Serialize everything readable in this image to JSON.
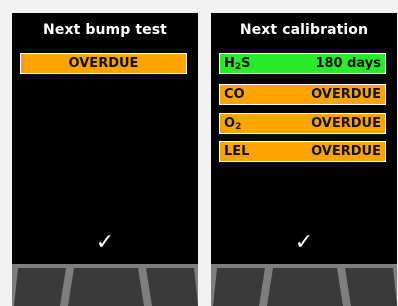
{
  "bump": {
    "title": "Next bump test",
    "status": "OVERDUE",
    "confirm_icon": "checkmark-icon",
    "status_color": "#ffa300"
  },
  "calibration": {
    "title": "Next calibration",
    "rows": [
      {
        "gas": "H",
        "sub": "2",
        "gas_rest": "S",
        "value": "180 days",
        "color": "#2bea2b"
      },
      {
        "gas": "CO",
        "sub": "",
        "gas_rest": "",
        "value": "OVERDUE",
        "color": "#ffa300"
      },
      {
        "gas": "O",
        "sub": "2",
        "gas_rest": "",
        "value": "OVERDUE",
        "color": "#ffa300"
      },
      {
        "gas": "LEL",
        "sub": "",
        "gas_rest": "",
        "value": "OVERDUE",
        "color": "#ffa300"
      }
    ],
    "confirm_icon": "checkmark-icon"
  },
  "check_glyph": "✓"
}
